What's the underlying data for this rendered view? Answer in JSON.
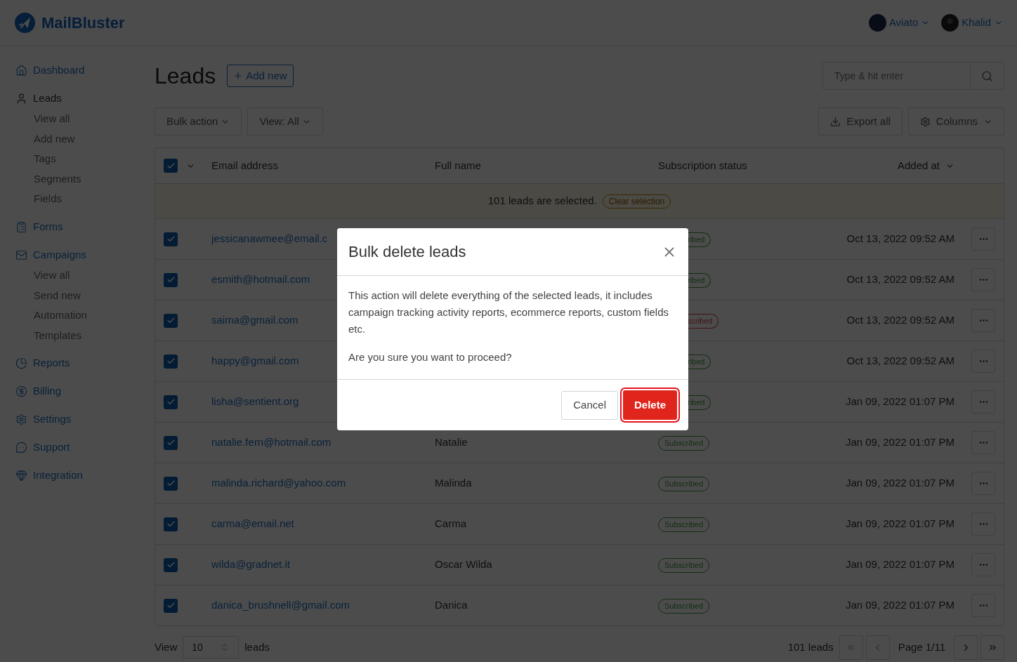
{
  "header": {
    "logo_text": "MailBluster",
    "accounts": [
      {
        "name": "Aviato"
      },
      {
        "name": "Khalid"
      }
    ]
  },
  "sidebar": {
    "items": [
      {
        "label": "Dashboard",
        "selected": false
      },
      {
        "label": "Leads",
        "selected": true,
        "children": [
          {
            "label": "View all"
          },
          {
            "label": "Add new"
          },
          {
            "label": "Tags"
          },
          {
            "label": "Segments"
          },
          {
            "label": "Fields"
          }
        ]
      },
      {
        "label": "Forms",
        "selected": false
      },
      {
        "label": "Campaigns",
        "selected": false,
        "children": [
          {
            "label": "View all"
          },
          {
            "label": "Send new"
          },
          {
            "label": "Automation"
          },
          {
            "label": "Templates"
          }
        ]
      },
      {
        "label": "Reports",
        "selected": false
      },
      {
        "label": "Billing",
        "selected": false
      },
      {
        "label": "Settings",
        "selected": false
      },
      {
        "label": "Support",
        "selected": false
      },
      {
        "label": "Integration",
        "selected": false
      }
    ]
  },
  "page": {
    "title": "Leads",
    "add_button": "Add new",
    "search": {
      "placeholder": "Type & hit enter"
    },
    "toolbar": {
      "bulk": "Bulk action",
      "view": "View: All",
      "export": "Export all",
      "columns": "Columns"
    }
  },
  "table": {
    "select_all": true,
    "columns": [
      "Email address",
      "Full name",
      "Subscription status",
      "Added at"
    ],
    "banner": {
      "text": "101 leads are selected.",
      "button": "Clear selection"
    },
    "rows": [
      {
        "checked": true,
        "email": "jessicanawmee@email.c",
        "status": {
          "text": "ribed",
          "kind": "subscribed",
          "partial": true
        },
        "added": "Oct 13, 2022 09:52 AM"
      },
      {
        "checked": true,
        "email": "esmith@hotmail.com",
        "status": {
          "text": "ribed",
          "kind": "subscribed",
          "partial": true
        },
        "added": "Oct 13, 2022 09:52 AM"
      },
      {
        "checked": true,
        "email": "saima@gmail.com",
        "status": {
          "text": "scribed",
          "kind": "unsubscribed",
          "partial": true
        },
        "added": "Oct 13, 2022 09:52 AM"
      },
      {
        "checked": true,
        "email": "happy@gmail.com",
        "status": {
          "text": "ribed",
          "kind": "subscribed",
          "partial": true
        },
        "added": "Oct 13, 2022 09:52 AM"
      },
      {
        "checked": true,
        "email": "lisha@sentient.org",
        "status": {
          "text": "ribed",
          "kind": "subscribed",
          "partial": true
        },
        "added": "Jan 09, 2022 01:07 PM"
      },
      {
        "checked": true,
        "email": "natalie.fern@hotmail.com",
        "name": "Natalie",
        "status": {
          "text": "Subscribed",
          "kind": "subscribed",
          "partial": false
        },
        "added": "Jan 09, 2022 01:07 PM"
      },
      {
        "checked": true,
        "email": "malinda.richard@yahoo.com",
        "name": "Malinda",
        "status": {
          "text": "Subscribed",
          "kind": "subscribed",
          "partial": false
        },
        "added": "Jan 09, 2022 01:07 PM"
      },
      {
        "checked": true,
        "email": "carma@email.net",
        "name": "Carma",
        "status": {
          "text": "Subscribed",
          "kind": "subscribed",
          "partial": false
        },
        "added": "Jan 09, 2022 01:07 PM"
      },
      {
        "checked": true,
        "email": "wilda@gradnet.it",
        "name": "Oscar Wilda",
        "status": {
          "text": "Subscribed",
          "kind": "subscribed",
          "partial": false
        },
        "added": "Jan 09, 2022 01:07 PM"
      },
      {
        "checked": true,
        "email": "danica_brushnell@gmail.com",
        "name": "Danica",
        "status": {
          "text": "Subscribed",
          "kind": "subscribed",
          "partial": false
        },
        "added": "Jan 09, 2022 01:07 PM"
      }
    ]
  },
  "footer": {
    "view_label": "View",
    "page_size": "10",
    "leads_label": "leads",
    "total": "101 leads",
    "page": "Page 1/11"
  },
  "modal": {
    "title": "Bulk delete leads",
    "paragraphs": [
      "This action will delete everything of the selected leads, it includes campaign tracking activity reports, ecommerce reports, custom fields etc.",
      "Are you sure you want to proceed?"
    ],
    "cancel": "Cancel",
    "delete": "Delete"
  }
}
